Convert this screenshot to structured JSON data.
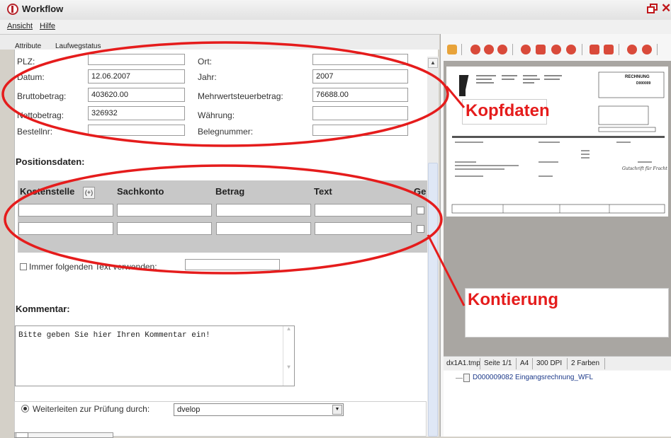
{
  "window": {
    "title": "Workflow",
    "close_glyph": "✕"
  },
  "menu": [
    "Ansicht",
    "Hilfe"
  ],
  "tabs": [
    "Attribute",
    "Laufwegstatus"
  ],
  "header_fields": {
    "plz": {
      "label": "PLZ:",
      "value": ""
    },
    "ort": {
      "label": "Ort:",
      "value": ""
    },
    "datum": {
      "label": "Datum:",
      "value": "12.06.2007"
    },
    "jahr": {
      "label": "Jahr:",
      "value": "2007"
    },
    "brutto": {
      "label": "Bruttobetrag:",
      "value": "403620.00"
    },
    "mwst": {
      "label": "Mehrwertsteuerbetrag:",
      "value": "76688.00"
    },
    "netto": {
      "label": "Nettobetrag:",
      "value": "326932"
    },
    "waehrung": {
      "label": "Währung:",
      "value": ""
    },
    "bestellnr": {
      "label": "Bestellnr:",
      "value": ""
    },
    "belegnummer": {
      "label": "Belegnummer:",
      "value": ""
    }
  },
  "positions": {
    "title": "Positionsdaten:",
    "add_button": "(+)",
    "columns": [
      "Kostenstelle",
      "Sachkonto",
      "Betrag",
      "Text",
      "Ge"
    ],
    "checkbox_label": "Immer folgenden Text verwenden:"
  },
  "comment": {
    "title": "Kommentar:",
    "text": "Bitte geben Sie hier Ihren Kommentar ein!"
  },
  "forward": {
    "label": "Weiterleiten zur Prüfung durch:",
    "selected": "dvelop"
  },
  "preview": {
    "invoice_heading": "RECHNUNG",
    "invoice_number": "D000009",
    "handwriting": "Gutschrift für Fracht",
    "status": [
      "dx1A1.tmp",
      "Seite 1/1",
      "A4",
      "300 DPI",
      "2 Farben"
    ],
    "tree_item": "D000009082 Eingangsrechnung_WFL"
  },
  "annotations": {
    "kopfdaten": "Kopfdaten",
    "kontierung": "Kontierung"
  },
  "colors": {
    "annotation_red": "#e51c1c",
    "logo_red": "#b6232a"
  }
}
